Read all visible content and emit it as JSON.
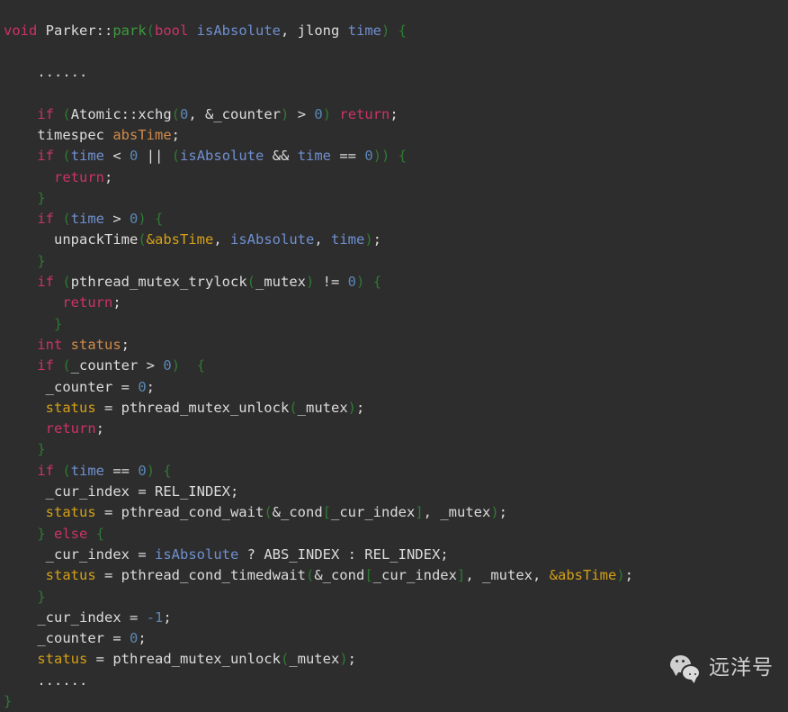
{
  "theme": {
    "background": "#2d2d2d",
    "keyword": "#cc3366",
    "function_name": "#3f9a3f",
    "plain_text": "#dcdcdc",
    "parameter": "#6f8fd0",
    "number": "#5b87b5",
    "bracket": "#2f7a33",
    "variable_declaration": "#d18b4b",
    "variable_usage": "#d4a017"
  },
  "code": {
    "language": "cpp",
    "lines": [
      {
        "n": 1,
        "indent": 0,
        "tokens": [
          {
            "t": "void",
            "c": "t-kw"
          },
          {
            "t": " ",
            "c": "t-plain"
          },
          {
            "t": "Parker::",
            "c": "t-plain"
          },
          {
            "t": "park",
            "c": "t-fn"
          },
          {
            "t": "(",
            "c": "t-paren"
          },
          {
            "t": "bool",
            "c": "t-kw"
          },
          {
            "t": " ",
            "c": "t-plain"
          },
          {
            "t": "isAbsolute",
            "c": "t-param"
          },
          {
            "t": ", ",
            "c": "t-plain"
          },
          {
            "t": "jlong",
            "c": "t-plain"
          },
          {
            "t": " ",
            "c": "t-plain"
          },
          {
            "t": "time",
            "c": "t-param"
          },
          {
            "t": ")",
            "c": "t-paren"
          },
          {
            "t": " ",
            "c": "t-plain"
          },
          {
            "t": "{",
            "c": "t-paren"
          }
        ]
      },
      {
        "n": 2,
        "indent": 0,
        "tokens": []
      },
      {
        "n": 3,
        "indent": 4,
        "tokens": [
          {
            "t": "......",
            "c": "t-dots"
          }
        ]
      },
      {
        "n": 4,
        "indent": 0,
        "tokens": []
      },
      {
        "n": 5,
        "indent": 4,
        "tokens": [
          {
            "t": "if",
            "c": "t-kw"
          },
          {
            "t": " ",
            "c": "t-plain"
          },
          {
            "t": "(",
            "c": "t-paren"
          },
          {
            "t": "Atomic::xchg",
            "c": "t-plain"
          },
          {
            "t": "(",
            "c": "t-paren"
          },
          {
            "t": "0",
            "c": "t-num"
          },
          {
            "t": ", &_counter",
            "c": "t-plain"
          },
          {
            "t": ")",
            "c": "t-paren"
          },
          {
            "t": " > ",
            "c": "t-plain"
          },
          {
            "t": "0",
            "c": "t-num"
          },
          {
            "t": ")",
            "c": "t-paren"
          },
          {
            "t": " ",
            "c": "t-plain"
          },
          {
            "t": "return",
            "c": "t-kw"
          },
          {
            "t": ";",
            "c": "t-plain"
          }
        ]
      },
      {
        "n": 6,
        "indent": 4,
        "tokens": [
          {
            "t": "timespec",
            "c": "t-plain"
          },
          {
            "t": " ",
            "c": "t-plain"
          },
          {
            "t": "absTime",
            "c": "t-var-decl"
          },
          {
            "t": ";",
            "c": "t-plain"
          }
        ]
      },
      {
        "n": 7,
        "indent": 4,
        "tokens": [
          {
            "t": "if",
            "c": "t-kw"
          },
          {
            "t": " ",
            "c": "t-plain"
          },
          {
            "t": "(",
            "c": "t-paren"
          },
          {
            "t": "time",
            "c": "t-param"
          },
          {
            "t": " < ",
            "c": "t-plain"
          },
          {
            "t": "0",
            "c": "t-num"
          },
          {
            "t": " || ",
            "c": "t-plain"
          },
          {
            "t": "(",
            "c": "t-paren"
          },
          {
            "t": "isAbsolute",
            "c": "t-param"
          },
          {
            "t": " && ",
            "c": "t-plain"
          },
          {
            "t": "time",
            "c": "t-param"
          },
          {
            "t": " == ",
            "c": "t-plain"
          },
          {
            "t": "0",
            "c": "t-num"
          },
          {
            "t": "))",
            "c": "t-paren"
          },
          {
            "t": " ",
            "c": "t-plain"
          },
          {
            "t": "{",
            "c": "t-paren"
          }
        ]
      },
      {
        "n": 8,
        "indent": 6,
        "tokens": [
          {
            "t": "return",
            "c": "t-kw"
          },
          {
            "t": ";",
            "c": "t-plain"
          }
        ]
      },
      {
        "n": 9,
        "indent": 4,
        "tokens": [
          {
            "t": "}",
            "c": "t-paren"
          }
        ]
      },
      {
        "n": 10,
        "indent": 4,
        "tokens": [
          {
            "t": "if",
            "c": "t-kw"
          },
          {
            "t": " ",
            "c": "t-plain"
          },
          {
            "t": "(",
            "c": "t-paren"
          },
          {
            "t": "time",
            "c": "t-param"
          },
          {
            "t": " > ",
            "c": "t-plain"
          },
          {
            "t": "0",
            "c": "t-num"
          },
          {
            "t": ")",
            "c": "t-paren"
          },
          {
            "t": " ",
            "c": "t-plain"
          },
          {
            "t": "{",
            "c": "t-paren"
          }
        ]
      },
      {
        "n": 11,
        "indent": 6,
        "tokens": [
          {
            "t": "unpackTime",
            "c": "t-plain"
          },
          {
            "t": "(",
            "c": "t-paren"
          },
          {
            "t": "&absTime",
            "c": "t-var-use"
          },
          {
            "t": ", ",
            "c": "t-plain"
          },
          {
            "t": "isAbsolute",
            "c": "t-param"
          },
          {
            "t": ", ",
            "c": "t-plain"
          },
          {
            "t": "time",
            "c": "t-param"
          },
          {
            "t": ")",
            "c": "t-paren"
          },
          {
            "t": ";",
            "c": "t-plain"
          }
        ]
      },
      {
        "n": 12,
        "indent": 4,
        "tokens": [
          {
            "t": "}",
            "c": "t-paren"
          }
        ]
      },
      {
        "n": 13,
        "indent": 4,
        "tokens": [
          {
            "t": "if",
            "c": "t-kw"
          },
          {
            "t": " ",
            "c": "t-plain"
          },
          {
            "t": "(",
            "c": "t-paren"
          },
          {
            "t": "pthread_mutex_trylock",
            "c": "t-plain"
          },
          {
            "t": "(",
            "c": "t-paren"
          },
          {
            "t": "_mutex",
            "c": "t-plain"
          },
          {
            "t": ")",
            "c": "t-paren"
          },
          {
            "t": " != ",
            "c": "t-plain"
          },
          {
            "t": "0",
            "c": "t-num"
          },
          {
            "t": ")",
            "c": "t-paren"
          },
          {
            "t": " ",
            "c": "t-plain"
          },
          {
            "t": "{",
            "c": "t-paren"
          }
        ]
      },
      {
        "n": 14,
        "indent": 7,
        "tokens": [
          {
            "t": "return",
            "c": "t-kw"
          },
          {
            "t": ";",
            "c": "t-plain"
          }
        ]
      },
      {
        "n": 15,
        "indent": 6,
        "tokens": [
          {
            "t": "}",
            "c": "t-paren"
          }
        ]
      },
      {
        "n": 16,
        "indent": 4,
        "tokens": [
          {
            "t": "int",
            "c": "t-kw"
          },
          {
            "t": " ",
            "c": "t-plain"
          },
          {
            "t": "status",
            "c": "t-var-decl"
          },
          {
            "t": ";",
            "c": "t-plain"
          }
        ]
      },
      {
        "n": 17,
        "indent": 4,
        "tokens": [
          {
            "t": "if",
            "c": "t-kw"
          },
          {
            "t": " ",
            "c": "t-plain"
          },
          {
            "t": "(",
            "c": "t-paren"
          },
          {
            "t": "_counter",
            "c": "t-plain"
          },
          {
            "t": " > ",
            "c": "t-plain"
          },
          {
            "t": "0",
            "c": "t-num"
          },
          {
            "t": ")",
            "c": "t-paren"
          },
          {
            "t": "  ",
            "c": "t-plain"
          },
          {
            "t": "{",
            "c": "t-paren"
          }
        ]
      },
      {
        "n": 18,
        "indent": 5,
        "tokens": [
          {
            "t": "_counter = ",
            "c": "t-plain"
          },
          {
            "t": "0",
            "c": "t-num"
          },
          {
            "t": ";",
            "c": "t-plain"
          }
        ]
      },
      {
        "n": 19,
        "indent": 5,
        "tokens": [
          {
            "t": "status",
            "c": "t-var-use"
          },
          {
            "t": " = pthread_mutex_unlock",
            "c": "t-plain"
          },
          {
            "t": "(",
            "c": "t-paren"
          },
          {
            "t": "_mutex",
            "c": "t-plain"
          },
          {
            "t": ")",
            "c": "t-paren"
          },
          {
            "t": ";",
            "c": "t-plain"
          }
        ]
      },
      {
        "n": 20,
        "indent": 5,
        "tokens": [
          {
            "t": "return",
            "c": "t-kw"
          },
          {
            "t": ";",
            "c": "t-plain"
          }
        ]
      },
      {
        "n": 21,
        "indent": 4,
        "tokens": [
          {
            "t": "}",
            "c": "t-paren"
          }
        ]
      },
      {
        "n": 22,
        "indent": 4,
        "tokens": [
          {
            "t": "if",
            "c": "t-kw"
          },
          {
            "t": " ",
            "c": "t-plain"
          },
          {
            "t": "(",
            "c": "t-paren"
          },
          {
            "t": "time",
            "c": "t-param"
          },
          {
            "t": " == ",
            "c": "t-plain"
          },
          {
            "t": "0",
            "c": "t-num"
          },
          {
            "t": ")",
            "c": "t-paren"
          },
          {
            "t": " ",
            "c": "t-plain"
          },
          {
            "t": "{",
            "c": "t-paren"
          }
        ]
      },
      {
        "n": 23,
        "indent": 5,
        "tokens": [
          {
            "t": "_cur_index = REL_INDEX;",
            "c": "t-plain"
          }
        ]
      },
      {
        "n": 24,
        "indent": 5,
        "tokens": [
          {
            "t": "status",
            "c": "t-var-use"
          },
          {
            "t": " = pthread_cond_wait",
            "c": "t-plain"
          },
          {
            "t": "(",
            "c": "t-paren"
          },
          {
            "t": "&_cond",
            "c": "t-plain"
          },
          {
            "t": "[",
            "c": "t-bracket"
          },
          {
            "t": "_cur_index",
            "c": "t-plain"
          },
          {
            "t": "]",
            "c": "t-bracket"
          },
          {
            "t": ", _mutex",
            "c": "t-plain"
          },
          {
            "t": ")",
            "c": "t-paren"
          },
          {
            "t": ";",
            "c": "t-plain"
          }
        ]
      },
      {
        "n": 25,
        "indent": 4,
        "tokens": [
          {
            "t": "}",
            "c": "t-paren"
          },
          {
            "t": " ",
            "c": "t-plain"
          },
          {
            "t": "else",
            "c": "t-kw"
          },
          {
            "t": " ",
            "c": "t-plain"
          },
          {
            "t": "{",
            "c": "t-paren"
          }
        ]
      },
      {
        "n": 26,
        "indent": 5,
        "tokens": [
          {
            "t": "_cur_index = ",
            "c": "t-plain"
          },
          {
            "t": "isAbsolute",
            "c": "t-param"
          },
          {
            "t": " ? ABS_INDEX : REL_INDEX;",
            "c": "t-plain"
          }
        ]
      },
      {
        "n": 27,
        "indent": 5,
        "tokens": [
          {
            "t": "status",
            "c": "t-var-use"
          },
          {
            "t": " = pthread_cond_timedwait",
            "c": "t-plain"
          },
          {
            "t": "(",
            "c": "t-paren"
          },
          {
            "t": "&_cond",
            "c": "t-plain"
          },
          {
            "t": "[",
            "c": "t-bracket"
          },
          {
            "t": "_cur_index",
            "c": "t-plain"
          },
          {
            "t": "]",
            "c": "t-bracket"
          },
          {
            "t": ", _mutex, ",
            "c": "t-plain"
          },
          {
            "t": "&absTime",
            "c": "t-var-use"
          },
          {
            "t": ")",
            "c": "t-paren"
          },
          {
            "t": ";",
            "c": "t-plain"
          }
        ]
      },
      {
        "n": 28,
        "indent": 4,
        "tokens": [
          {
            "t": "}",
            "c": "t-paren"
          }
        ]
      },
      {
        "n": 29,
        "indent": 4,
        "tokens": [
          {
            "t": "_cur_index = ",
            "c": "t-plain"
          },
          {
            "t": "-1",
            "c": "t-num"
          },
          {
            "t": ";",
            "c": "t-plain"
          }
        ]
      },
      {
        "n": 30,
        "indent": 4,
        "tokens": [
          {
            "t": "_counter = ",
            "c": "t-plain"
          },
          {
            "t": "0",
            "c": "t-num"
          },
          {
            "t": ";",
            "c": "t-plain"
          }
        ]
      },
      {
        "n": 31,
        "indent": 4,
        "tokens": [
          {
            "t": "status",
            "c": "t-var-use"
          },
          {
            "t": " = pthread_mutex_unlock",
            "c": "t-plain"
          },
          {
            "t": "(",
            "c": "t-paren"
          },
          {
            "t": "_mutex",
            "c": "t-plain"
          },
          {
            "t": ")",
            "c": "t-paren"
          },
          {
            "t": ";",
            "c": "t-plain"
          }
        ]
      },
      {
        "n": 32,
        "indent": 4,
        "tokens": [
          {
            "t": "......",
            "c": "t-dots"
          }
        ]
      },
      {
        "n": 33,
        "indent": 0,
        "tokens": [
          {
            "t": "}",
            "c": "t-paren"
          }
        ]
      }
    ],
    "plain_text": "void Parker::park(bool isAbsolute, jlong time) {\n\n    ......\n\n    if (Atomic::xchg(0, &_counter) > 0) return;\n    timespec absTime;\n    if (time < 0 || (isAbsolute && time == 0)) {\n      return;\n    }\n    if (time > 0) {\n      unpackTime(&absTime, isAbsolute, time);\n    }\n    if (pthread_mutex_trylock(_mutex) != 0) {\n       return;\n      }\n    int status;\n    if (_counter > 0)  {\n     _counter = 0;\n     status = pthread_mutex_unlock(_mutex);\n     return;\n    }\n    if (time == 0) {\n     _cur_index = REL_INDEX;\n     status = pthread_cond_wait(&_cond[_cur_index], _mutex);\n    } else {\n     _cur_index = isAbsolute ? ABS_INDEX : REL_INDEX;\n     status = pthread_cond_timedwait(&_cond[_cur_index], _mutex, &absTime);\n    }\n    _cur_index = -1;\n    _counter = 0;\n    status = pthread_mutex_unlock(_mutex);\n    ......\n}"
  },
  "watermark": {
    "icon": "wechat-logo-icon",
    "label": "远洋号"
  }
}
